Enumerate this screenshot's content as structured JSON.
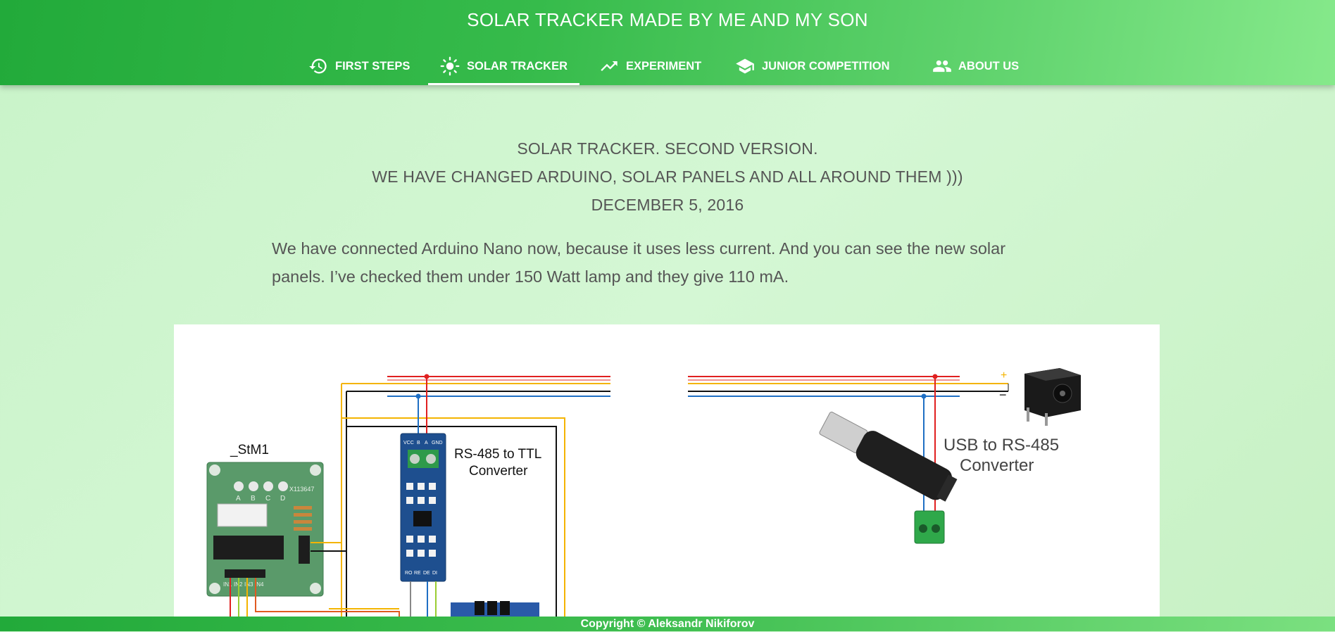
{
  "header": {
    "title": "SOLAR TRACKER MADE BY ME AND MY SON",
    "nav": [
      {
        "label": "FIRST STEPS",
        "icon": "history-icon"
      },
      {
        "label": "SOLAR TRACKER",
        "icon": "sun-icon",
        "active": true
      },
      {
        "label": "EXPERIMENT",
        "icon": "trending-up-icon"
      },
      {
        "label": "JUNIOR COMPETITION",
        "icon": "graduation-cap-icon"
      },
      {
        "label": "ABOUT US",
        "icon": "people-icon"
      }
    ]
  },
  "main": {
    "heading_lines": [
      "SOLAR TRACKER. SECOND VERSION.",
      "WE HAVE CHANGED ARDUINO, SOLAR PANELS AND ALL AROUND THEM )))",
      "DECEMBER 5, 2016"
    ],
    "paragraph": "We have connected Arduino Nano now, because it uses less current. And you can see the new solar panels. I’ve checked them under 150 Watt lamp and they give 110 mA.",
    "diagram": {
      "stepper_label": "_StM1",
      "rs485_ttl_label_1": "RS-485 to TTL",
      "rs485_ttl_label_2": "Converter",
      "usb_label_1": "USB to RS-485",
      "usb_label_2": "Converter",
      "plus_sign": "+",
      "minus_sign": "−",
      "driver_code": "X113647",
      "driver_pins": [
        "A",
        "B",
        "C",
        "D"
      ],
      "driver_inputs": [
        "IN1",
        "IN2",
        "IN3",
        "IN4"
      ],
      "rs485_top_pins": [
        "VCC",
        "B",
        "A",
        "GND"
      ],
      "rs485_bottom_pins": [
        "RO",
        "RE",
        "DE",
        "DI"
      ]
    }
  },
  "footer": {
    "copyright": "Copyright © Aleksandr Nikiforov"
  }
}
